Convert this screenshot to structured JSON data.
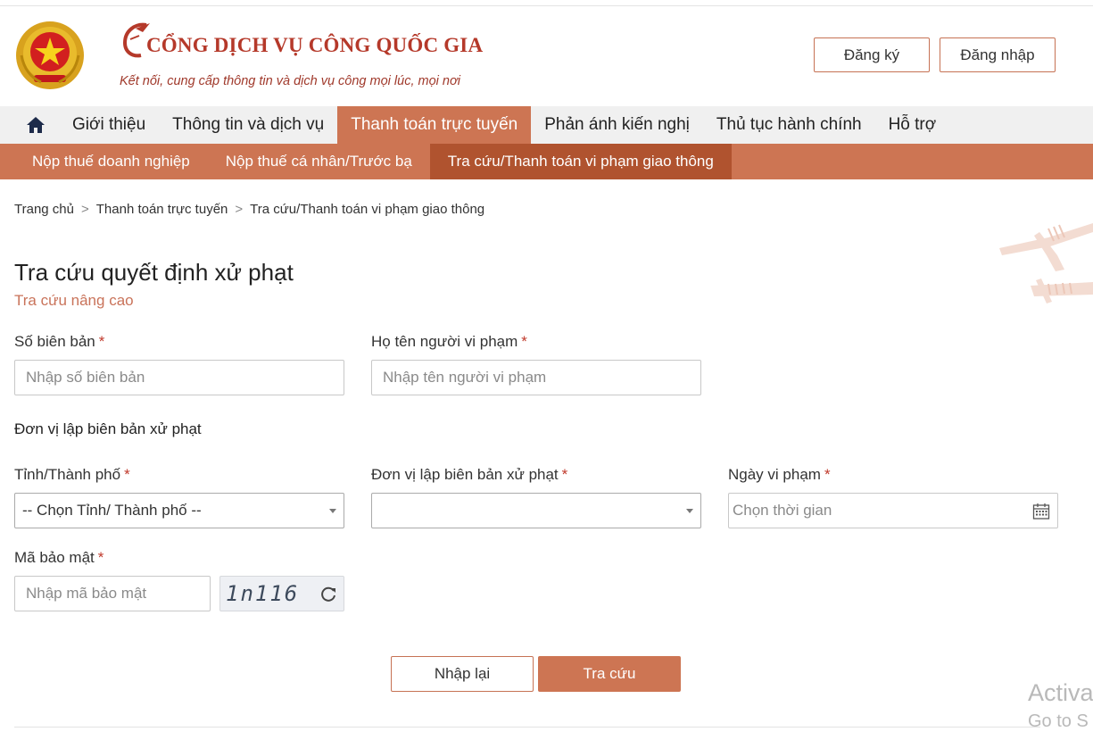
{
  "header": {
    "title": "CỔNG DỊCH VỤ CÔNG QUỐC GIA",
    "subtitle": "Kết nối, cung cấp thông tin và dịch vụ công mọi lúc, mọi nơi",
    "register_label": "Đăng ký",
    "login_label": "Đăng nhập"
  },
  "main_nav": {
    "items": [
      {
        "label": "Giới thiệu"
      },
      {
        "label": "Thông tin và dịch vụ"
      },
      {
        "label": "Thanh toán trực tuyến",
        "active": true
      },
      {
        "label": "Phản ánh kiến nghị"
      },
      {
        "label": "Thủ tục hành chính"
      },
      {
        "label": "Hỗ trợ"
      }
    ]
  },
  "sub_nav": {
    "items": [
      {
        "label": "Nộp thuế doanh nghiệp"
      },
      {
        "label": "Nộp thuế cá nhân/Trước bạ"
      },
      {
        "label": "Tra cứu/Thanh toán vi phạm giao thông",
        "active": true
      }
    ]
  },
  "breadcrumb": {
    "items": [
      "Trang chủ",
      "Thanh toán trực tuyến",
      "Tra cứu/Thanh toán vi phạm giao thông"
    ],
    "separator": ">"
  },
  "page": {
    "title": "Tra cứu quyết định xử phạt",
    "advanced_link": "Tra cứu nâng cao"
  },
  "form": {
    "required_mark": "*",
    "record_number": {
      "label": "Số biên bản",
      "placeholder": "Nhập số biên bản",
      "value": ""
    },
    "violator_name": {
      "label": "Họ tên người vi phạm",
      "placeholder": "Nhập tên người vi phạm",
      "value": ""
    },
    "section_label": "Đơn vị lập biên bản xử phạt",
    "province": {
      "label": "Tỉnh/Thành phố",
      "selected": "-- Chọn Tỉnh/ Thành phố --"
    },
    "issuing_unit": {
      "label": "Đơn vị lập biên bản xử phạt",
      "selected": ""
    },
    "violation_date": {
      "label": "Ngày vi phạm",
      "placeholder": "Chọn thời gian"
    },
    "captcha": {
      "label": "Mã bảo mật",
      "placeholder": "Nhập mã bảo mật",
      "code": "1n116"
    },
    "reset_label": "Nhập lại",
    "search_label": "Tra cứu"
  },
  "windows_watermark": {
    "line1": "Activa",
    "line2": "Go to S"
  },
  "colors": {
    "brand": "#cd7553",
    "brand_dark": "#b0532f",
    "title_red": "#b5392a",
    "required": "#c0392b"
  },
  "icons": [
    "national-emblem-icon",
    "bird-logo-icon",
    "home-icon",
    "calendar-icon",
    "refresh-icon",
    "chevron-down-icon"
  ]
}
